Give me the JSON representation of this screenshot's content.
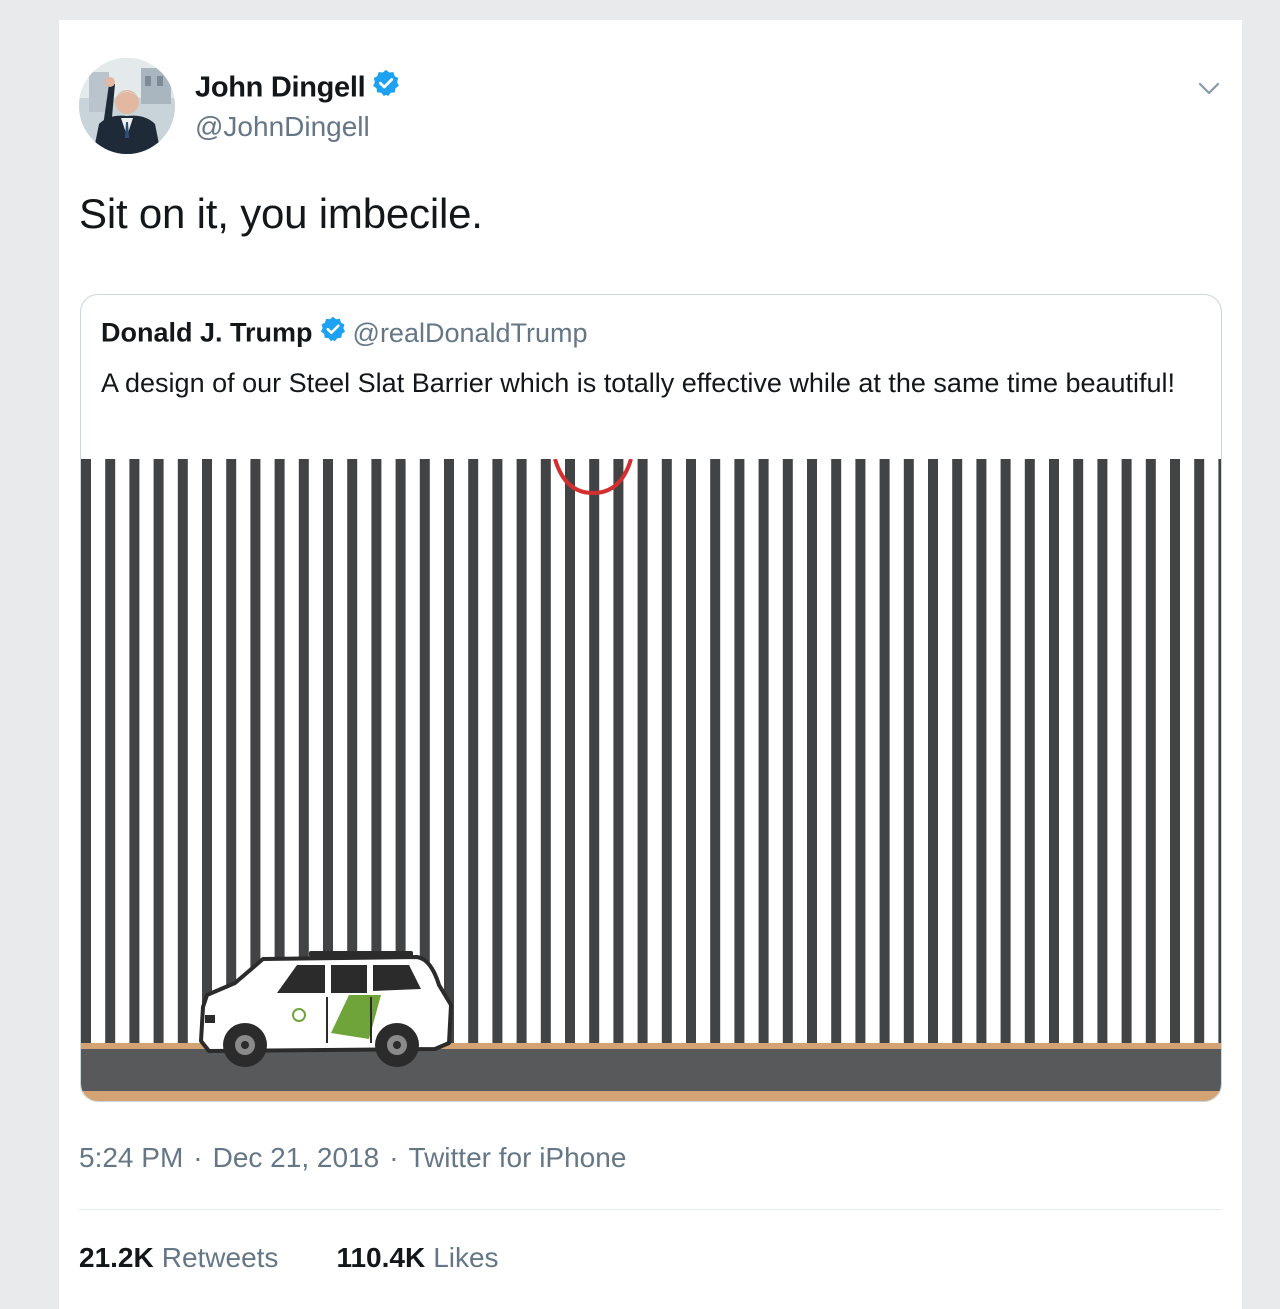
{
  "tweet": {
    "author": {
      "display_name": "John Dingell",
      "handle": "@JohnDingell",
      "verified": true
    },
    "text": "Sit on it, you imbecile.",
    "quoted": {
      "display_name": "Donald J. Trump",
      "handle": "@realDonaldTrump",
      "verified": true,
      "text": "A design of our Steel Slat Barrier which is totally effective while at the same time beautiful!"
    },
    "meta": {
      "time": "5:24 PM",
      "date": "Dec 21, 2018",
      "source": "Twitter for iPhone",
      "separator": "·"
    },
    "stats": {
      "retweets_count": "21.2K",
      "retweets_label": "Retweets",
      "likes_count": "110.4K",
      "likes_label": "Likes"
    }
  },
  "colors": {
    "verified_blue": "#1da1f2",
    "secondary_text": "#657786",
    "slat_color": "#424345",
    "ground_color": "#58595b",
    "stripe_color": "#d4a373",
    "vehicle_stripe": "#6ea43a",
    "highlight_circle": "#d32f2f"
  }
}
